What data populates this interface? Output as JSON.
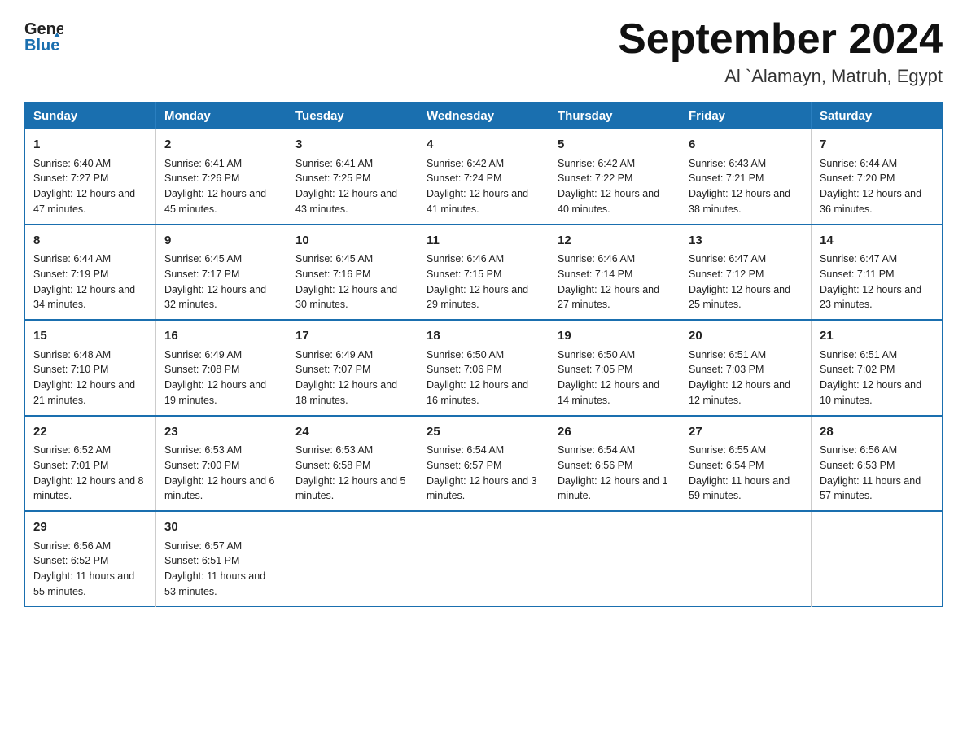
{
  "header": {
    "logo_general": "General",
    "logo_blue": "Blue",
    "title": "September 2024",
    "subtitle": "Al `Alamayn, Matruh, Egypt"
  },
  "days_of_week": [
    "Sunday",
    "Monday",
    "Tuesday",
    "Wednesday",
    "Thursday",
    "Friday",
    "Saturday"
  ],
  "weeks": [
    [
      {
        "day": "1",
        "sunrise": "Sunrise: 6:40 AM",
        "sunset": "Sunset: 7:27 PM",
        "daylight": "Daylight: 12 hours and 47 minutes."
      },
      {
        "day": "2",
        "sunrise": "Sunrise: 6:41 AM",
        "sunset": "Sunset: 7:26 PM",
        "daylight": "Daylight: 12 hours and 45 minutes."
      },
      {
        "day": "3",
        "sunrise": "Sunrise: 6:41 AM",
        "sunset": "Sunset: 7:25 PM",
        "daylight": "Daylight: 12 hours and 43 minutes."
      },
      {
        "day": "4",
        "sunrise": "Sunrise: 6:42 AM",
        "sunset": "Sunset: 7:24 PM",
        "daylight": "Daylight: 12 hours and 41 minutes."
      },
      {
        "day": "5",
        "sunrise": "Sunrise: 6:42 AM",
        "sunset": "Sunset: 7:22 PM",
        "daylight": "Daylight: 12 hours and 40 minutes."
      },
      {
        "day": "6",
        "sunrise": "Sunrise: 6:43 AM",
        "sunset": "Sunset: 7:21 PM",
        "daylight": "Daylight: 12 hours and 38 minutes."
      },
      {
        "day": "7",
        "sunrise": "Sunrise: 6:44 AM",
        "sunset": "Sunset: 7:20 PM",
        "daylight": "Daylight: 12 hours and 36 minutes."
      }
    ],
    [
      {
        "day": "8",
        "sunrise": "Sunrise: 6:44 AM",
        "sunset": "Sunset: 7:19 PM",
        "daylight": "Daylight: 12 hours and 34 minutes."
      },
      {
        "day": "9",
        "sunrise": "Sunrise: 6:45 AM",
        "sunset": "Sunset: 7:17 PM",
        "daylight": "Daylight: 12 hours and 32 minutes."
      },
      {
        "day": "10",
        "sunrise": "Sunrise: 6:45 AM",
        "sunset": "Sunset: 7:16 PM",
        "daylight": "Daylight: 12 hours and 30 minutes."
      },
      {
        "day": "11",
        "sunrise": "Sunrise: 6:46 AM",
        "sunset": "Sunset: 7:15 PM",
        "daylight": "Daylight: 12 hours and 29 minutes."
      },
      {
        "day": "12",
        "sunrise": "Sunrise: 6:46 AM",
        "sunset": "Sunset: 7:14 PM",
        "daylight": "Daylight: 12 hours and 27 minutes."
      },
      {
        "day": "13",
        "sunrise": "Sunrise: 6:47 AM",
        "sunset": "Sunset: 7:12 PM",
        "daylight": "Daylight: 12 hours and 25 minutes."
      },
      {
        "day": "14",
        "sunrise": "Sunrise: 6:47 AM",
        "sunset": "Sunset: 7:11 PM",
        "daylight": "Daylight: 12 hours and 23 minutes."
      }
    ],
    [
      {
        "day": "15",
        "sunrise": "Sunrise: 6:48 AM",
        "sunset": "Sunset: 7:10 PM",
        "daylight": "Daylight: 12 hours and 21 minutes."
      },
      {
        "day": "16",
        "sunrise": "Sunrise: 6:49 AM",
        "sunset": "Sunset: 7:08 PM",
        "daylight": "Daylight: 12 hours and 19 minutes."
      },
      {
        "day": "17",
        "sunrise": "Sunrise: 6:49 AM",
        "sunset": "Sunset: 7:07 PM",
        "daylight": "Daylight: 12 hours and 18 minutes."
      },
      {
        "day": "18",
        "sunrise": "Sunrise: 6:50 AM",
        "sunset": "Sunset: 7:06 PM",
        "daylight": "Daylight: 12 hours and 16 minutes."
      },
      {
        "day": "19",
        "sunrise": "Sunrise: 6:50 AM",
        "sunset": "Sunset: 7:05 PM",
        "daylight": "Daylight: 12 hours and 14 minutes."
      },
      {
        "day": "20",
        "sunrise": "Sunrise: 6:51 AM",
        "sunset": "Sunset: 7:03 PM",
        "daylight": "Daylight: 12 hours and 12 minutes."
      },
      {
        "day": "21",
        "sunrise": "Sunrise: 6:51 AM",
        "sunset": "Sunset: 7:02 PM",
        "daylight": "Daylight: 12 hours and 10 minutes."
      }
    ],
    [
      {
        "day": "22",
        "sunrise": "Sunrise: 6:52 AM",
        "sunset": "Sunset: 7:01 PM",
        "daylight": "Daylight: 12 hours and 8 minutes."
      },
      {
        "day": "23",
        "sunrise": "Sunrise: 6:53 AM",
        "sunset": "Sunset: 7:00 PM",
        "daylight": "Daylight: 12 hours and 6 minutes."
      },
      {
        "day": "24",
        "sunrise": "Sunrise: 6:53 AM",
        "sunset": "Sunset: 6:58 PM",
        "daylight": "Daylight: 12 hours and 5 minutes."
      },
      {
        "day": "25",
        "sunrise": "Sunrise: 6:54 AM",
        "sunset": "Sunset: 6:57 PM",
        "daylight": "Daylight: 12 hours and 3 minutes."
      },
      {
        "day": "26",
        "sunrise": "Sunrise: 6:54 AM",
        "sunset": "Sunset: 6:56 PM",
        "daylight": "Daylight: 12 hours and 1 minute."
      },
      {
        "day": "27",
        "sunrise": "Sunrise: 6:55 AM",
        "sunset": "Sunset: 6:54 PM",
        "daylight": "Daylight: 11 hours and 59 minutes."
      },
      {
        "day": "28",
        "sunrise": "Sunrise: 6:56 AM",
        "sunset": "Sunset: 6:53 PM",
        "daylight": "Daylight: 11 hours and 57 minutes."
      }
    ],
    [
      {
        "day": "29",
        "sunrise": "Sunrise: 6:56 AM",
        "sunset": "Sunset: 6:52 PM",
        "daylight": "Daylight: 11 hours and 55 minutes."
      },
      {
        "day": "30",
        "sunrise": "Sunrise: 6:57 AM",
        "sunset": "Sunset: 6:51 PM",
        "daylight": "Daylight: 11 hours and 53 minutes."
      },
      null,
      null,
      null,
      null,
      null
    ]
  ]
}
